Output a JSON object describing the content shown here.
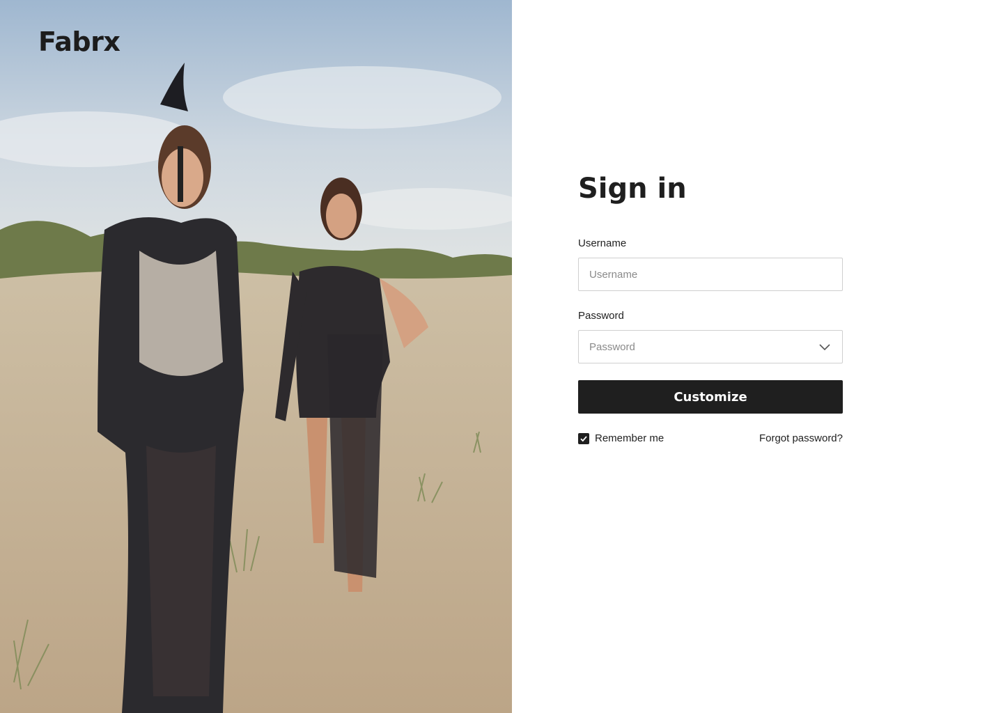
{
  "brand": {
    "logo_text": "Fabrx"
  },
  "hero": {
    "image_icon": "fashion-photo-image"
  },
  "form": {
    "title": "Sign in",
    "username": {
      "label": "Username",
      "placeholder": "Username"
    },
    "password": {
      "label": "Password",
      "placeholder": "Password",
      "icon": "chevron-down-icon"
    },
    "submit_label": "Customize",
    "remember_label": "Remember me",
    "remember_checked": true,
    "forgot_label": "Forgot password?"
  },
  "colors": {
    "primary": "#1f1f1f",
    "input_border": "#cfcfcf",
    "background": "#ffffff"
  }
}
